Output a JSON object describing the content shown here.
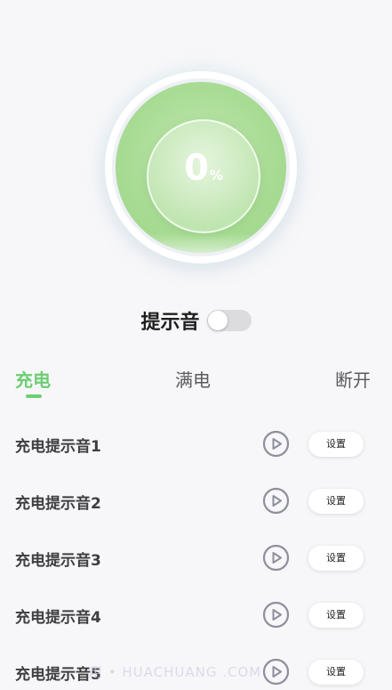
{
  "dial": {
    "percent_value": "0",
    "percent_unit": "%",
    "fill_color": "#a9dc95"
  },
  "alert": {
    "label": "提示音",
    "enabled": false
  },
  "tabs": [
    {
      "label": "充电",
      "active": true
    },
    {
      "label": "满电",
      "active": false
    },
    {
      "label": "断开",
      "active": false
    }
  ],
  "accent_color": "#6dce73",
  "sounds": [
    {
      "label": "充电提示音1",
      "action": "设置",
      "play_icon": "play-circle-icon"
    },
    {
      "label": "充电提示音2",
      "action": "设置",
      "play_icon": "play-circle-icon"
    },
    {
      "label": "充电提示音3",
      "action": "设置",
      "play_icon": "play-circle-icon"
    },
    {
      "label": "充电提示音4",
      "action": "设置",
      "play_icon": "play-circle-icon"
    },
    {
      "label": "充电提示音5",
      "action": "设置",
      "play_icon": "play-circle-icon"
    }
  ],
  "watermark": "用 • HUACHUANG  .COM"
}
